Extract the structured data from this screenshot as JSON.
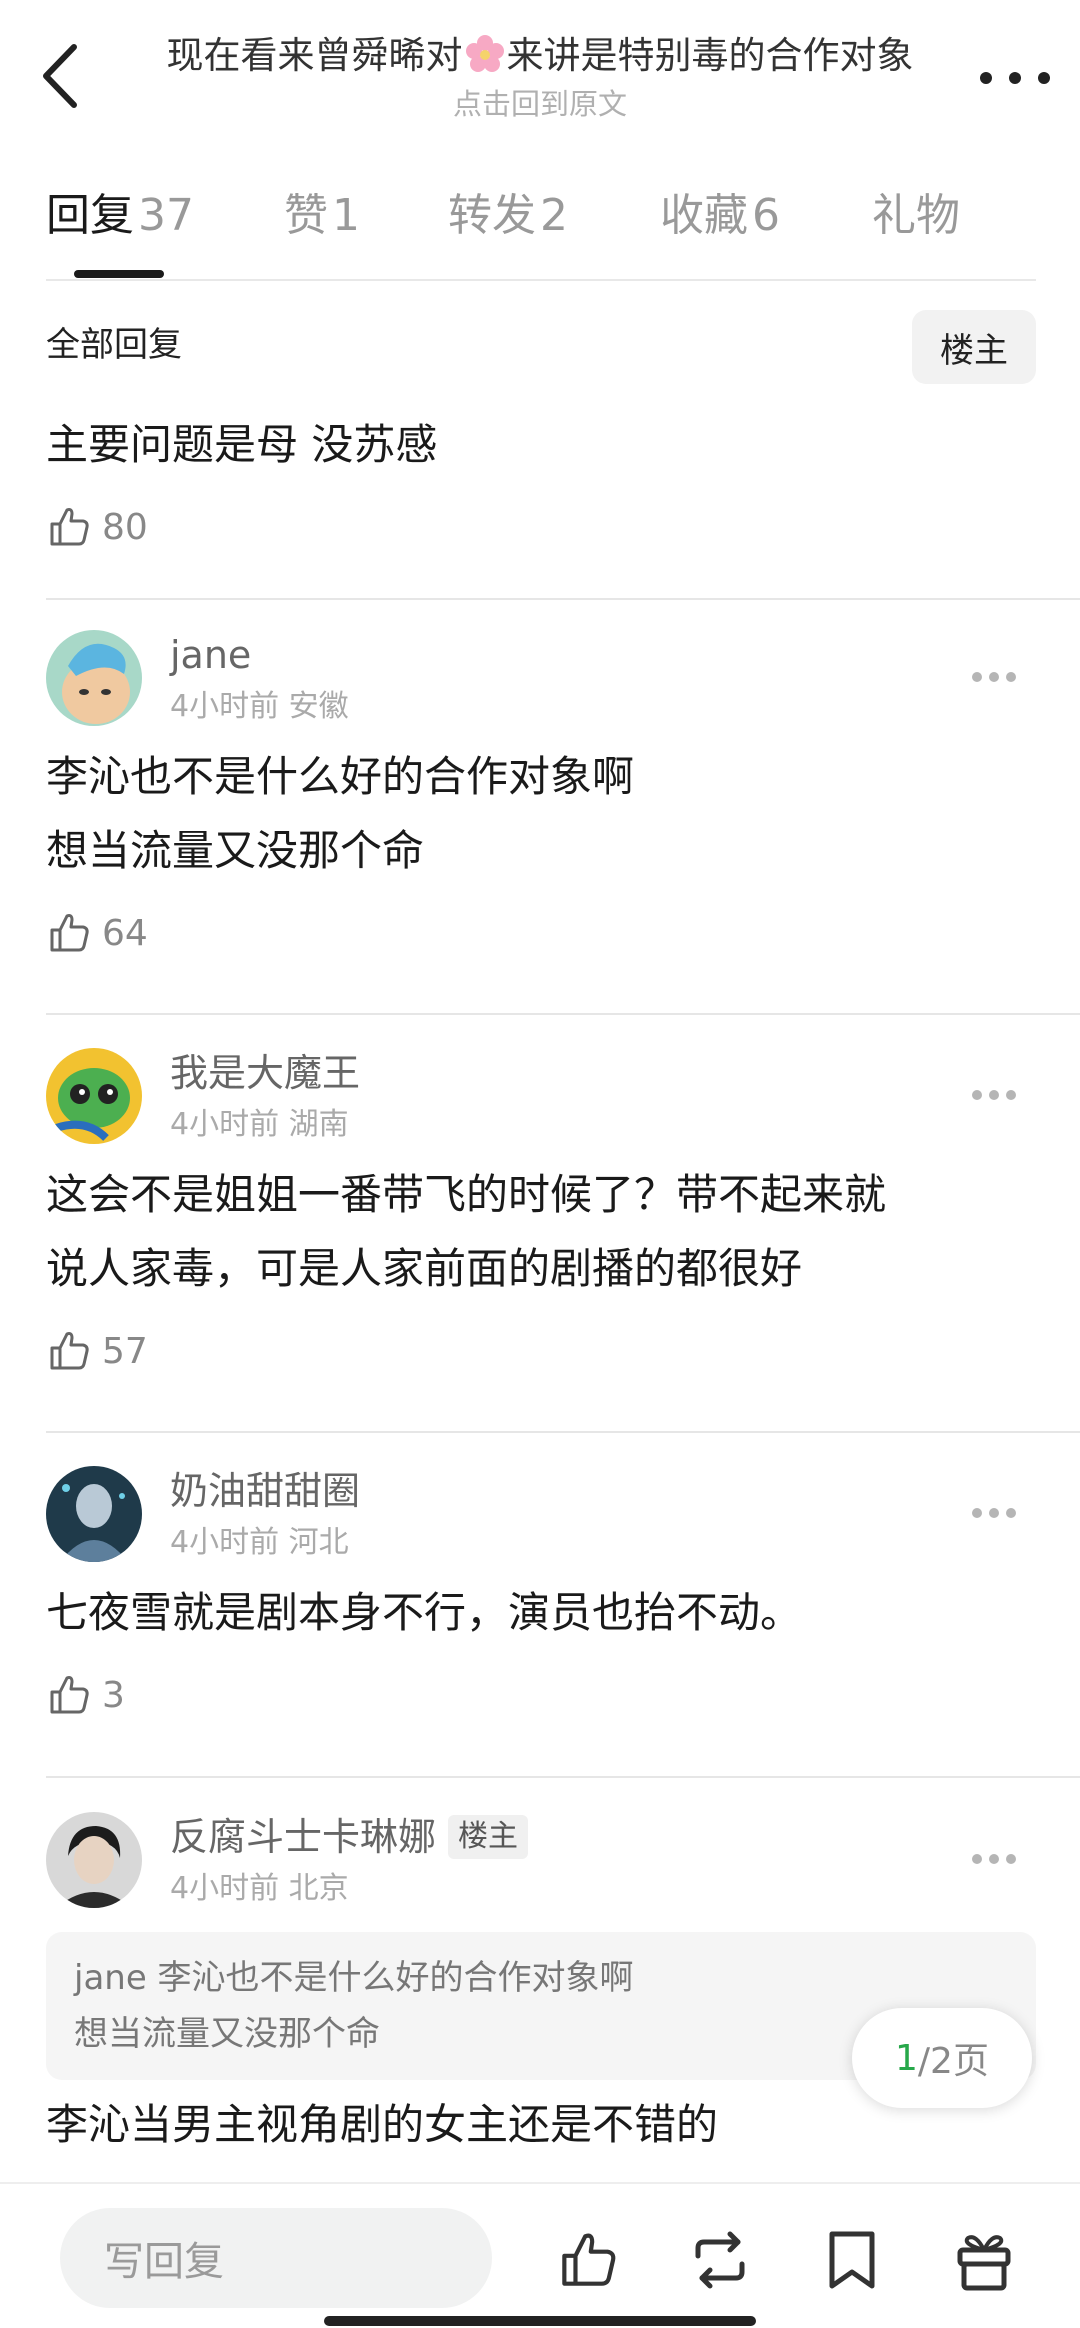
{
  "header": {
    "title_before": "现在看来曾舜晞对",
    "title_after": "来讲是特别毒的合作对象",
    "subtitle": "点击回到原文"
  },
  "tabs": [
    {
      "label": "回复",
      "count": "37"
    },
    {
      "label": "赞",
      "count": "1"
    },
    {
      "label": "转发",
      "count": "2"
    },
    {
      "label": "收藏",
      "count": "6"
    },
    {
      "label": "礼物",
      "count": ""
    }
  ],
  "subheader": {
    "all_replies": "全部回复",
    "op_filter": "楼主"
  },
  "root_comment": {
    "text": "主要问题是母 没苏感",
    "likes": "80"
  },
  "comments": [
    {
      "user": "jane",
      "time": "4小时前 安徽",
      "lines": [
        "李沁也不是什么好的合作对象啊",
        "想当流量又没那个命"
      ],
      "likes": "64"
    },
    {
      "user": "我是大魔王",
      "time": "4小时前 湖南",
      "lines": [
        "这会不是姐姐一番带飞的时候了？带不起来就",
        "说人家毒，可是人家前面的剧播的都很好"
      ],
      "likes": "57"
    },
    {
      "user": "奶油甜甜圈",
      "time": "4小时前 河北",
      "lines": [
        "七夜雪就是剧本身不行，演员也抬不动。"
      ],
      "likes": "3"
    },
    {
      "user": "反腐斗士卡琳娜",
      "badge": "楼主",
      "time": "4小时前 北京",
      "quote_lines": [
        "jane 李沁也不是什么好的合作对象啊",
        "想当流量又没那个命"
      ],
      "lines": [
        "李沁当男主视角剧的女主还是不错的"
      ]
    }
  ],
  "pager": {
    "current": "1",
    "total": "/2页"
  },
  "bottom_bar": {
    "reply_placeholder": "写回复"
  },
  "colors": {
    "accent_green": "#27a84a",
    "text_primary": "#1a1a1a",
    "text_secondary": "#999999"
  }
}
